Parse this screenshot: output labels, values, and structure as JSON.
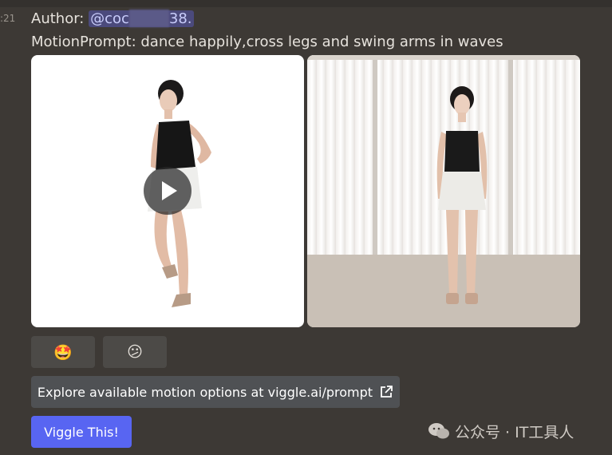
{
  "message": {
    "timestamp": ":21",
    "author_prefix": "Author: ",
    "mention_start": "@coc",
    "mention_end": "38.",
    "motion_prompt": "MotionPrompt: dance happily,cross legs and swing arms in waves"
  },
  "media": {
    "left_image": "person-cutout-video",
    "right_image": "person-standing-photo",
    "play_icon": "play-icon"
  },
  "reactions": [
    {
      "emoji": "🤩",
      "icon": "star-struck-emoji"
    },
    {
      "emoji": "😕",
      "icon": "confused-emoji"
    }
  ],
  "buttons": {
    "explore_label": "Explore available motion options at viggle.ai/prompt",
    "explore_icon": "external-link-icon",
    "viggle_label": "Viggle This!"
  },
  "watermark": {
    "text": "公众号 · IT工具人",
    "icon": "wechat-icon"
  },
  "colors": {
    "background": "#3d3935",
    "accent": "#5865f2",
    "mention_bg": "#4b4a7c",
    "button_gray": "#4f5154"
  }
}
